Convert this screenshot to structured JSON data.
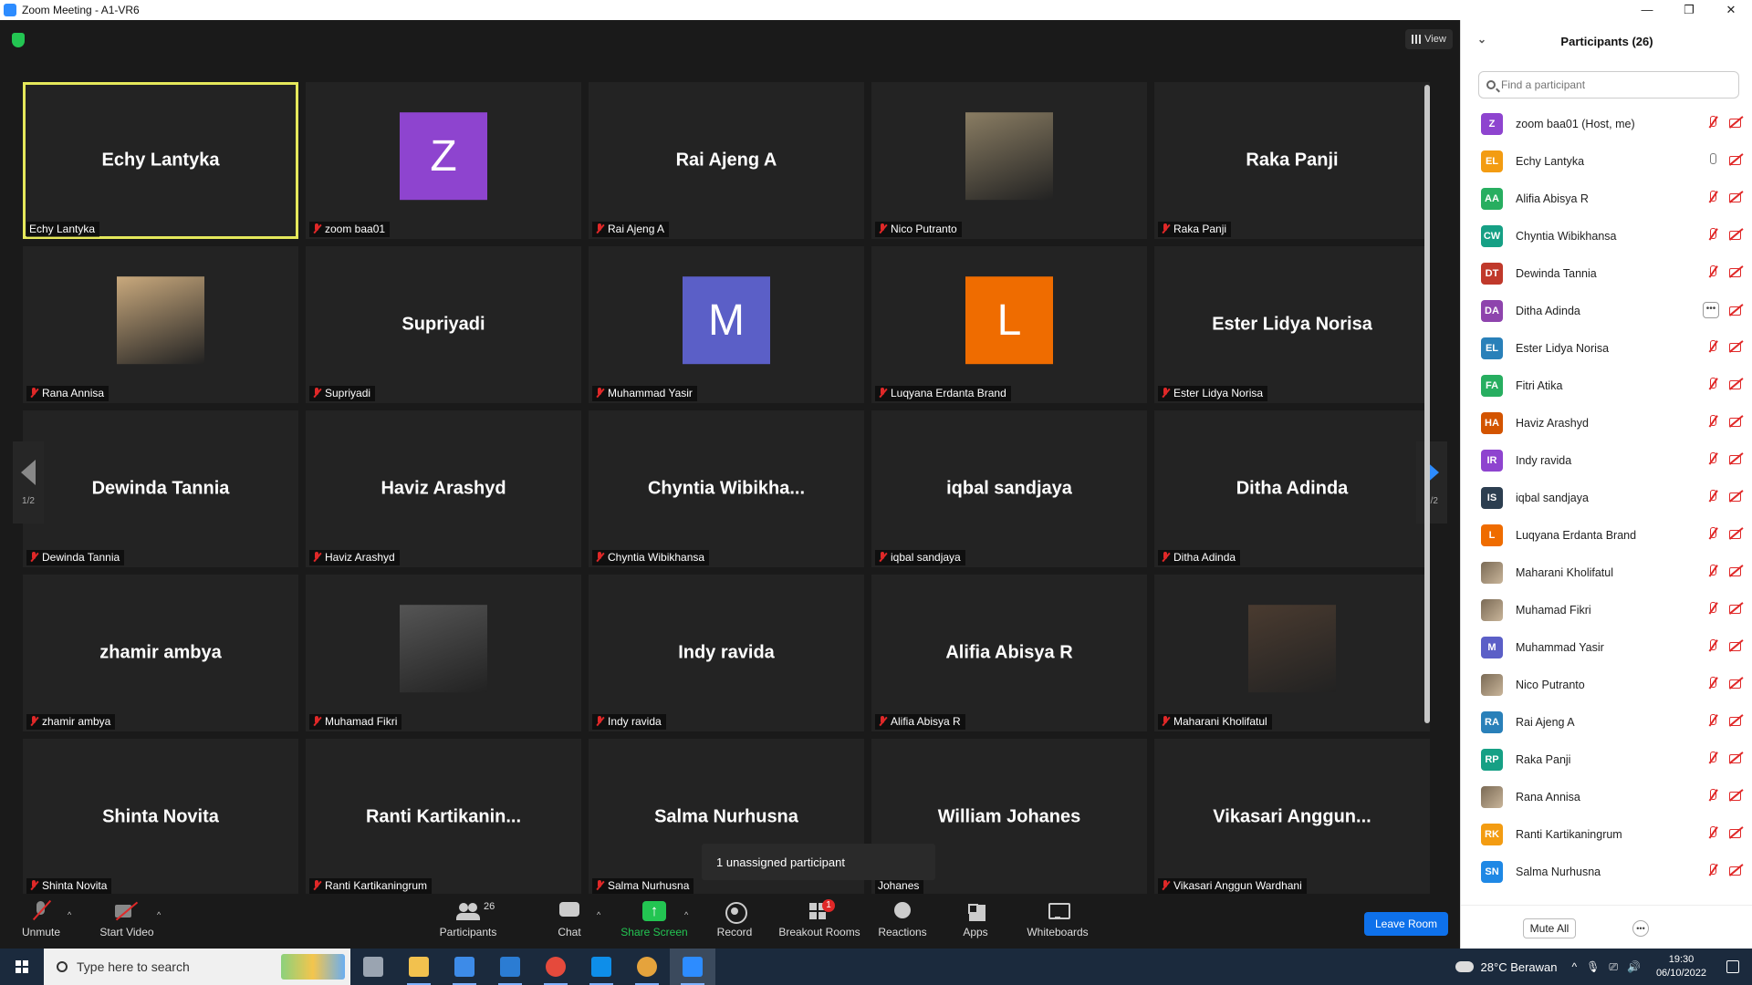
{
  "window": {
    "title": "Zoom Meeting - A1-VR6",
    "minimize": "—",
    "maximize": "❐",
    "close": "✕"
  },
  "video": {
    "view_label": "View",
    "page_indicator": "1/2",
    "tiles": [
      {
        "center": "Echy Lantyka",
        "caption": "Echy Lantyka",
        "active": true,
        "muted": false
      },
      {
        "avatar": "Z",
        "color": "#8e44cf",
        "caption": "zoom baa01",
        "muted": true
      },
      {
        "center": "Rai Ajeng A",
        "caption": "Rai Ajeng A",
        "muted": true
      },
      {
        "photo": "#8a7d63",
        "caption": "Nico Putranto",
        "muted": true
      },
      {
        "center": "Raka Panji",
        "caption": "Raka Panji",
        "muted": true
      },
      {
        "photo": "#c9a97d",
        "caption": "Rana Annisa",
        "muted": true
      },
      {
        "center": "Supriyadi",
        "caption": "Supriyadi",
        "muted": true
      },
      {
        "avatar": "M",
        "color": "#5b5fc7",
        "caption": "Muhammad Yasir",
        "muted": true
      },
      {
        "avatar": "L",
        "color": "#ef6c00",
        "caption": "Luqyana Erdanta Brand",
        "muted": true
      },
      {
        "center": "Ester Lidya Norisa",
        "caption": "Ester Lidya Norisa",
        "muted": true
      },
      {
        "center": "Dewinda Tannia",
        "caption": "Dewinda Tannia",
        "muted": true
      },
      {
        "center": "Haviz Arashyd",
        "caption": "Haviz Arashyd",
        "muted": true
      },
      {
        "center": "Chyntia Wibikha...",
        "caption": "Chyntia Wibikhansa",
        "muted": true
      },
      {
        "center": "iqbal sandjaya",
        "caption": "iqbal sandjaya",
        "muted": true
      },
      {
        "center": "Ditha Adinda",
        "caption": "Ditha Adinda",
        "muted": true
      },
      {
        "center": "zhamir ambya",
        "caption": "zhamir ambya",
        "muted": true
      },
      {
        "photo": "#555555",
        "caption": "Muhamad Fikri",
        "muted": true
      },
      {
        "center": "Indy ravida",
        "caption": "Indy ravida",
        "muted": true
      },
      {
        "center": "Alifia Abisya R",
        "caption": "Alifia Abisya R",
        "muted": true
      },
      {
        "photo": "#4a3b30",
        "caption": "Maharani Kholifatul",
        "muted": true
      },
      {
        "center": "Shinta Novita",
        "caption": "Shinta Novita",
        "muted": true
      },
      {
        "center": "Ranti Kartikanin...",
        "caption": "Ranti Kartikaningrum",
        "muted": true
      },
      {
        "center": "Salma Nurhusna",
        "caption": "Salma Nurhusna",
        "muted": true
      },
      {
        "center": "William Johanes",
        "caption": "Johanes",
        "muted": false
      },
      {
        "center": "Vikasari Anggun...",
        "caption": "Vikasari Anggun Wardhani",
        "muted": true
      }
    ],
    "popup": "1 unassigned participant"
  },
  "toolbar": {
    "unmute": "Unmute",
    "start_video": "Start Video",
    "participants": "Participants",
    "participants_count": "26",
    "chat": "Chat",
    "share_screen": "Share Screen",
    "record": "Record",
    "breakout_rooms": "Breakout Rooms",
    "breakout_badge": "1",
    "reactions": "Reactions",
    "apps": "Apps",
    "whiteboards": "Whiteboards",
    "leave_room": "Leave Room"
  },
  "panel": {
    "title": "Participants (26)",
    "search_placeholder": "Find a participant",
    "mute_all": "Mute All",
    "participants": [
      {
        "initials": "Z",
        "color": "#8e44cf",
        "name": "zoom baa01 (Host, me)",
        "mic": "muted"
      },
      {
        "initials": "EL",
        "color": "#f39c12",
        "name": "Echy Lantyka",
        "mic": "on"
      },
      {
        "initials": "AA",
        "color": "#27ae60",
        "name": "Alifia Abisya R",
        "mic": "muted"
      },
      {
        "initials": "CW",
        "color": "#16a085",
        "name": "Chyntia Wibikhansa",
        "mic": "muted"
      },
      {
        "initials": "DT",
        "color": "#c0392b",
        "name": "Dewinda Tannia",
        "mic": "muted"
      },
      {
        "initials": "DA",
        "color": "#8e44ad",
        "name": "Ditha Adinda",
        "mic": "more"
      },
      {
        "initials": "EL",
        "color": "#2980b9",
        "name": "Ester Lidya Norisa",
        "mic": "muted"
      },
      {
        "initials": "FA",
        "color": "#27ae60",
        "name": "Fitri Atika",
        "mic": "muted"
      },
      {
        "initials": "HA",
        "color": "#d35400",
        "name": "Haviz Arashyd",
        "mic": "muted"
      },
      {
        "initials": "IR",
        "color": "#8e44cf",
        "name": "Indy ravida",
        "mic": "muted"
      },
      {
        "initials": "IS",
        "color": "#2c3e50",
        "name": "iqbal sandjaya",
        "mic": "muted"
      },
      {
        "initials": "L",
        "color": "#ef6c00",
        "name": "Luqyana Erdanta Brand",
        "mic": "muted"
      },
      {
        "initials": "",
        "photo": true,
        "name": "Maharani Kholifatul",
        "mic": "muted"
      },
      {
        "initials": "",
        "photo": true,
        "name": "Muhamad Fikri",
        "mic": "muted"
      },
      {
        "initials": "M",
        "color": "#5b5fc7",
        "name": "Muhammad Yasir",
        "mic": "muted"
      },
      {
        "initials": "",
        "photo": true,
        "name": "Nico Putranto",
        "mic": "muted"
      },
      {
        "initials": "RA",
        "color": "#2980b9",
        "name": "Rai Ajeng A",
        "mic": "muted"
      },
      {
        "initials": "RP",
        "color": "#16a085",
        "name": "Raka Panji",
        "mic": "muted"
      },
      {
        "initials": "",
        "photo": true,
        "name": "Rana Annisa",
        "mic": "muted"
      },
      {
        "initials": "RK",
        "color": "#f39c12",
        "name": "Ranti Kartikaningrum",
        "mic": "muted"
      },
      {
        "initials": "SN",
        "color": "#1e88e5",
        "name": "Salma Nurhusna",
        "mic": "muted"
      }
    ]
  },
  "taskbar": {
    "search_placeholder": "Type here to search",
    "weather": "28°C Berawan",
    "time": "19:30",
    "date": "06/10/2022",
    "apps": [
      {
        "name": "task-view-icon",
        "color": "#9aa4b1"
      },
      {
        "name": "file-explorer-icon",
        "color": "#f2c14e"
      },
      {
        "name": "store-icon",
        "color": "#3d8be8"
      },
      {
        "name": "mail-icon",
        "color": "#2b7cd3"
      },
      {
        "name": "chrome-icon",
        "color": "#e54a3c"
      },
      {
        "name": "teamviewer-icon",
        "color": "#0e8ee9"
      },
      {
        "name": "chrome-profile-icon",
        "color": "#e5a33c"
      },
      {
        "name": "zoom-icon",
        "color": "#2d8cff"
      }
    ]
  }
}
